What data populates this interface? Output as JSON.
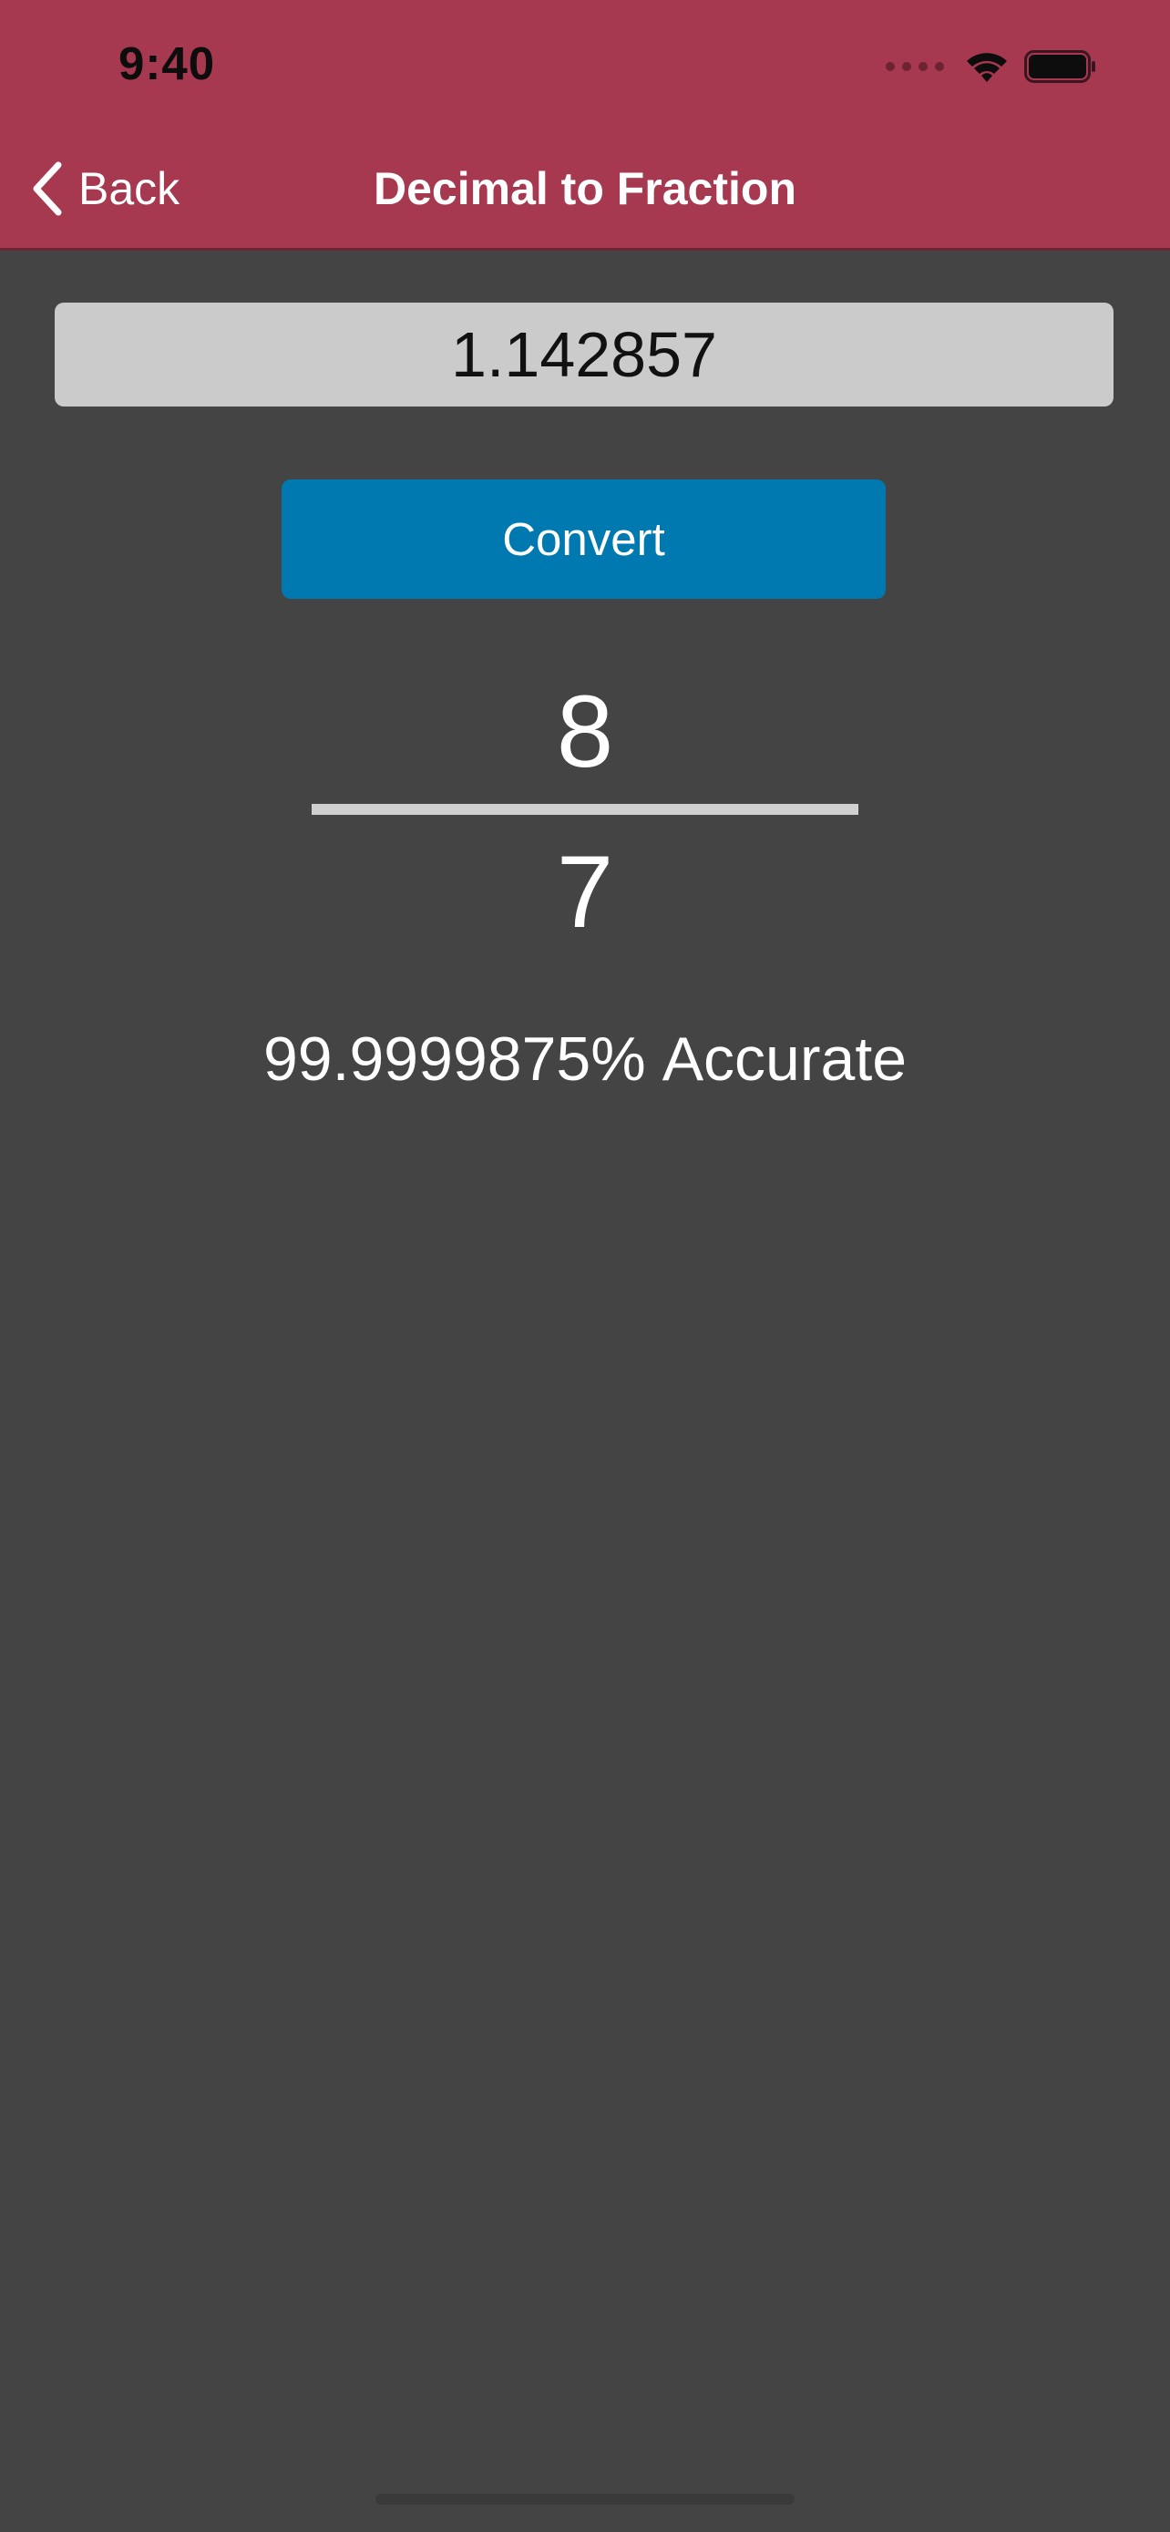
{
  "status_bar": {
    "time": "9:40",
    "icons": [
      "cellular-signal-icon",
      "wifi-icon",
      "battery-icon"
    ]
  },
  "nav": {
    "back_label": "Back",
    "title": "Decimal to Fraction",
    "back_icon": "chevron-left-icon"
  },
  "form": {
    "decimal_value": "1.142857",
    "convert_label": "Convert"
  },
  "result": {
    "numerator": "8",
    "denominator": "7",
    "accuracy_value": "99.9999875%",
    "accuracy_label": "Accurate"
  },
  "colors": {
    "header_background": "#a6384f",
    "page_background": "#444444",
    "input_background": "#cbcbcb",
    "button_background": "#0078b0",
    "text_primary": "#ffffff"
  }
}
